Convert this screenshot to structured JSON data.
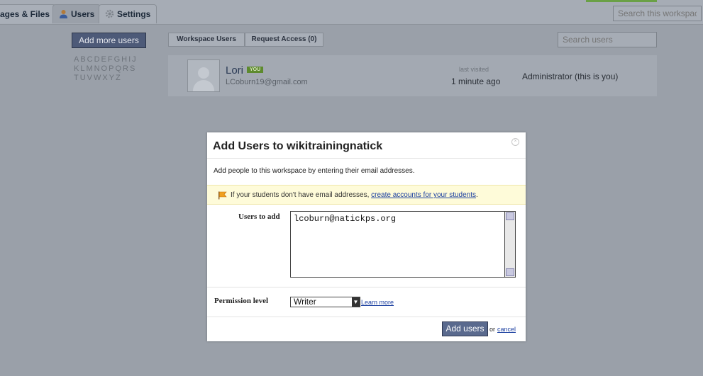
{
  "topbar": {
    "tabs": [
      {
        "label": "ages & Files",
        "icon": "pages-icon"
      },
      {
        "label": "Users",
        "icon": "users-icon",
        "active": true
      },
      {
        "label": "Settings",
        "icon": "settings-gear-icon"
      }
    ],
    "workspace_search_placeholder": "Search this workspace"
  },
  "sidebar": {
    "add_more_users_label": "Add more users",
    "alphabet": [
      "ABCDEFGHIJ",
      "KLMNOPQRS",
      "TUVWXYZ"
    ]
  },
  "subtabs": {
    "workspace_users": "Workspace Users",
    "request_access": "Request Access (0)"
  },
  "users_search_placeholder": "Search users",
  "user_row": {
    "name": "Lori",
    "you_badge": "YOU",
    "email": "LCoburn19@gmail.com",
    "last_visited_label": "last visited",
    "last_visited_value": "1 minute ago",
    "role": "Administrator (this is you)"
  },
  "modal": {
    "title": "Add Users to wikitrainingnatick",
    "description": "Add people to this workspace by entering their email addresses.",
    "note_prefix": "If your students don't have email addresses,",
    "note_link": "create accounts for your students",
    "note_suffix": ".",
    "users_to_add_label": "Users to add",
    "users_to_add_value": "lcoburn@natickps.org",
    "permission_label": "Permission level",
    "permission_value": "Writer",
    "learn_more": "Learn more",
    "add_users_button": "Add users",
    "or_text": "or",
    "cancel_link": "cancel"
  },
  "colors": {
    "overlay": "#9aa0a9",
    "you_badge": "#5d8a2e",
    "link": "#1b3fa0",
    "note_bg": "#fefbd9"
  }
}
